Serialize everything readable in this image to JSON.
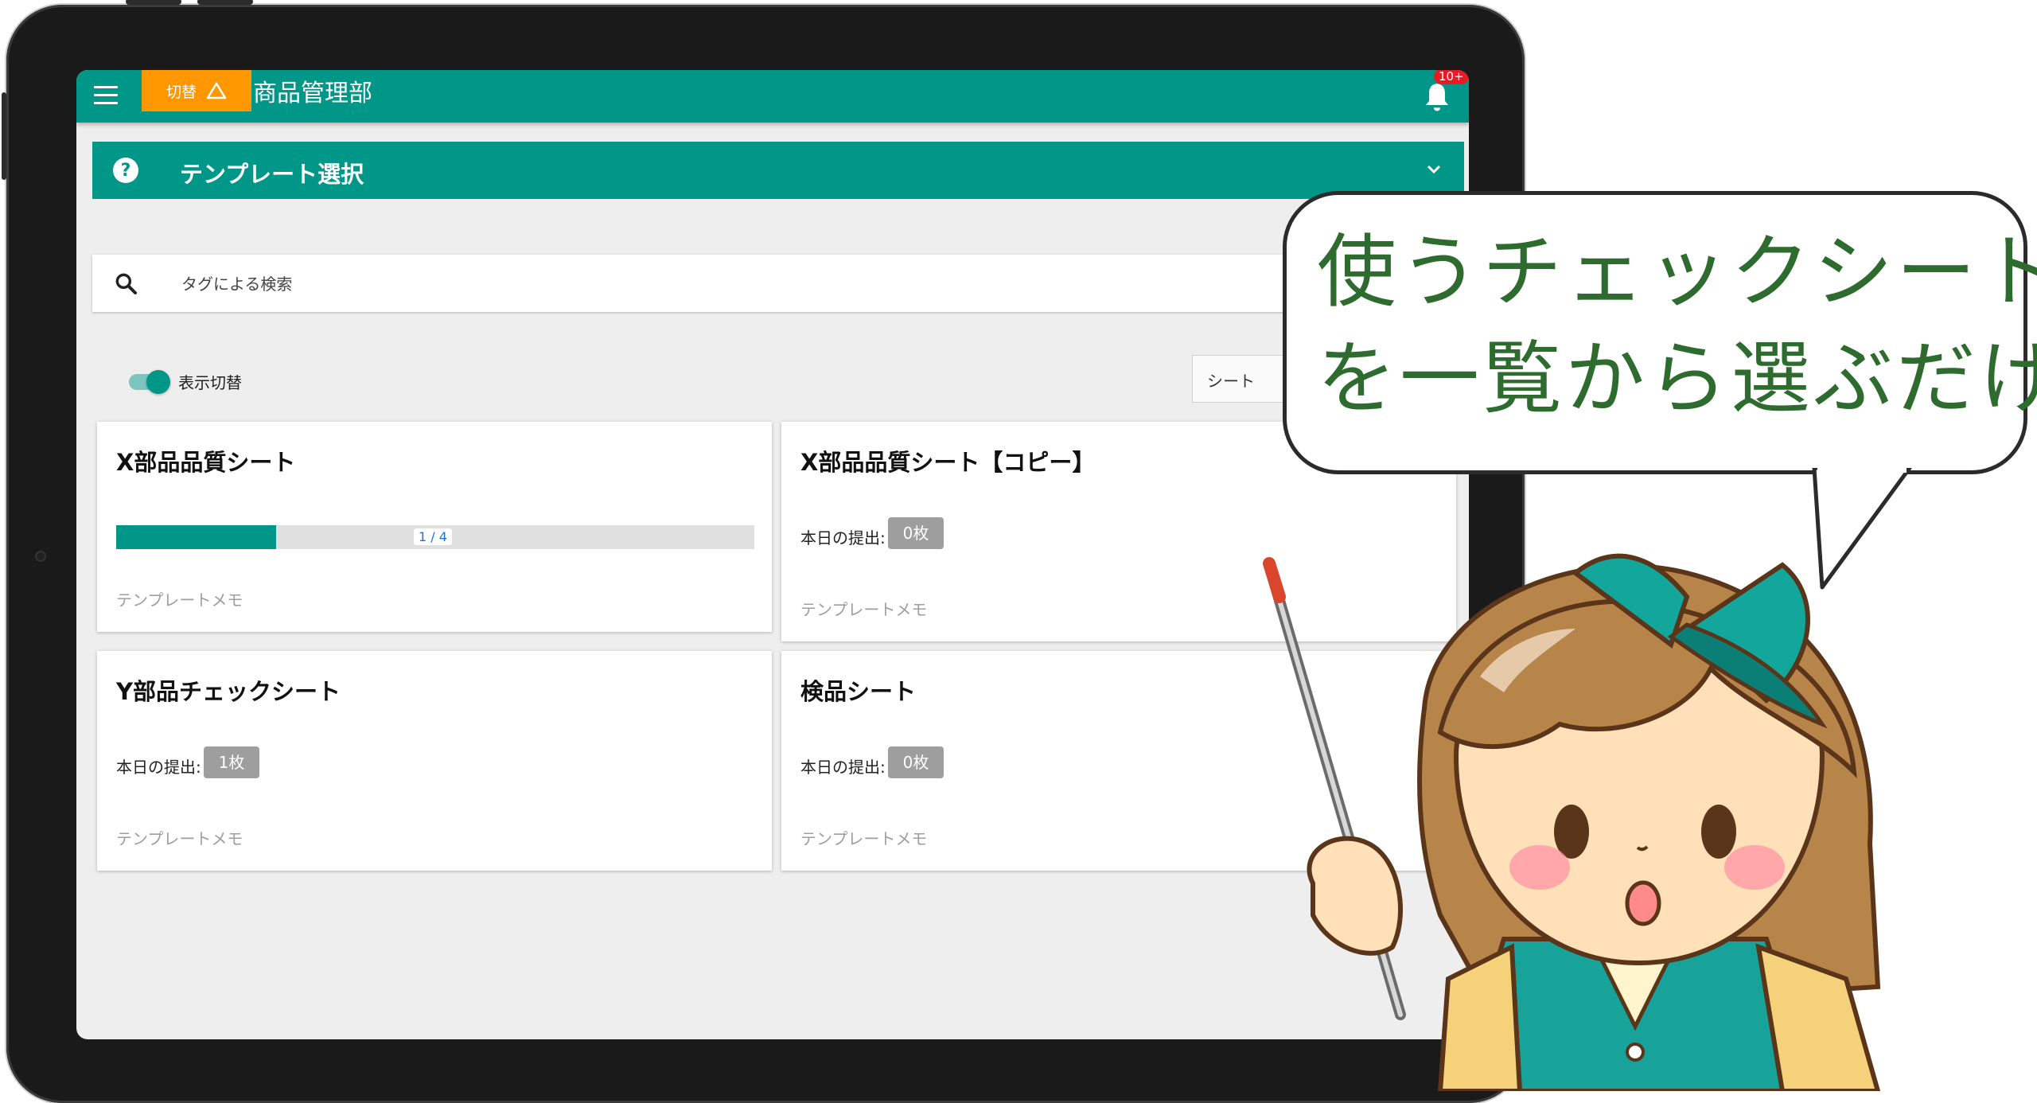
{
  "appbar": {
    "switch_label": "切替",
    "org_title": "商品管理部",
    "notification_badge": "10+"
  },
  "panel": {
    "title": "テンプレート選択"
  },
  "search": {
    "placeholder": "タグによる検索"
  },
  "toolbar": {
    "toggle_label": "表示切替",
    "toggle_on": true,
    "select_value": "シート"
  },
  "cards": [
    {
      "title": "X部品品質シート",
      "progress_text": "1 / 4",
      "progress_fraction": 0.25,
      "memo": "テンプレートメモ"
    },
    {
      "title": "X部品品質シート【コピー】",
      "submit_label": "本日の提出:",
      "count": "0枚",
      "memo": "テンプレートメモ"
    },
    {
      "title": "Y部品チェックシート",
      "submit_label": "本日の提出:",
      "count": "1枚",
      "memo": "テンプレートメモ"
    },
    {
      "title": "検品シート",
      "submit_label": "本日の提出:",
      "count": "0枚",
      "memo": "テンプレートメモ"
    }
  ],
  "bubble": {
    "line1": "使うチェックシート",
    "line2": "を一覧から選ぶだけ"
  },
  "colors": {
    "primary": "#009688",
    "accent": "#ff9800",
    "badge": "#e51c23",
    "bubble_text": "#2e6b2e"
  },
  "icons": [
    "menu-icon",
    "warning-icon",
    "bell-icon",
    "help-icon",
    "chevron-down-icon",
    "search-icon"
  ]
}
